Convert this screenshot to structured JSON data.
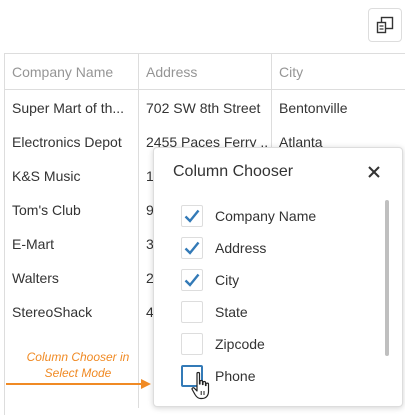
{
  "toolbar": {
    "column_chooser_button_icon": "column-chooser-icon"
  },
  "grid": {
    "headers": [
      "Company Name",
      "Address",
      "City"
    ],
    "rows": [
      [
        "Super Mart of th...",
        "702 SW 8th Street",
        "Bentonville"
      ],
      [
        "Electronics Depot",
        "2455 Paces Ferry ...",
        "Atlanta"
      ],
      [
        "K&S Music",
        "1",
        ""
      ],
      [
        "Tom's Club",
        "9",
        ""
      ],
      [
        "E-Mart",
        "3",
        ""
      ],
      [
        "Walters",
        "2",
        ""
      ],
      [
        "StereoShack",
        "4",
        ""
      ]
    ]
  },
  "column_chooser": {
    "title": "Column Chooser",
    "close_icon": "close-icon",
    "items": [
      {
        "label": "Company Name",
        "checked": true
      },
      {
        "label": "Address",
        "checked": true
      },
      {
        "label": "City",
        "checked": true
      },
      {
        "label": "State",
        "checked": false
      },
      {
        "label": "Zipcode",
        "checked": false
      },
      {
        "label": "Phone",
        "checked": false
      }
    ]
  },
  "annotation": {
    "line1": "Column Chooser in",
    "line2": "Select Mode"
  },
  "colors": {
    "accent": "#337ab7",
    "annotation": "#f08a24",
    "border": "#dddddd",
    "header_text": "#959595"
  }
}
